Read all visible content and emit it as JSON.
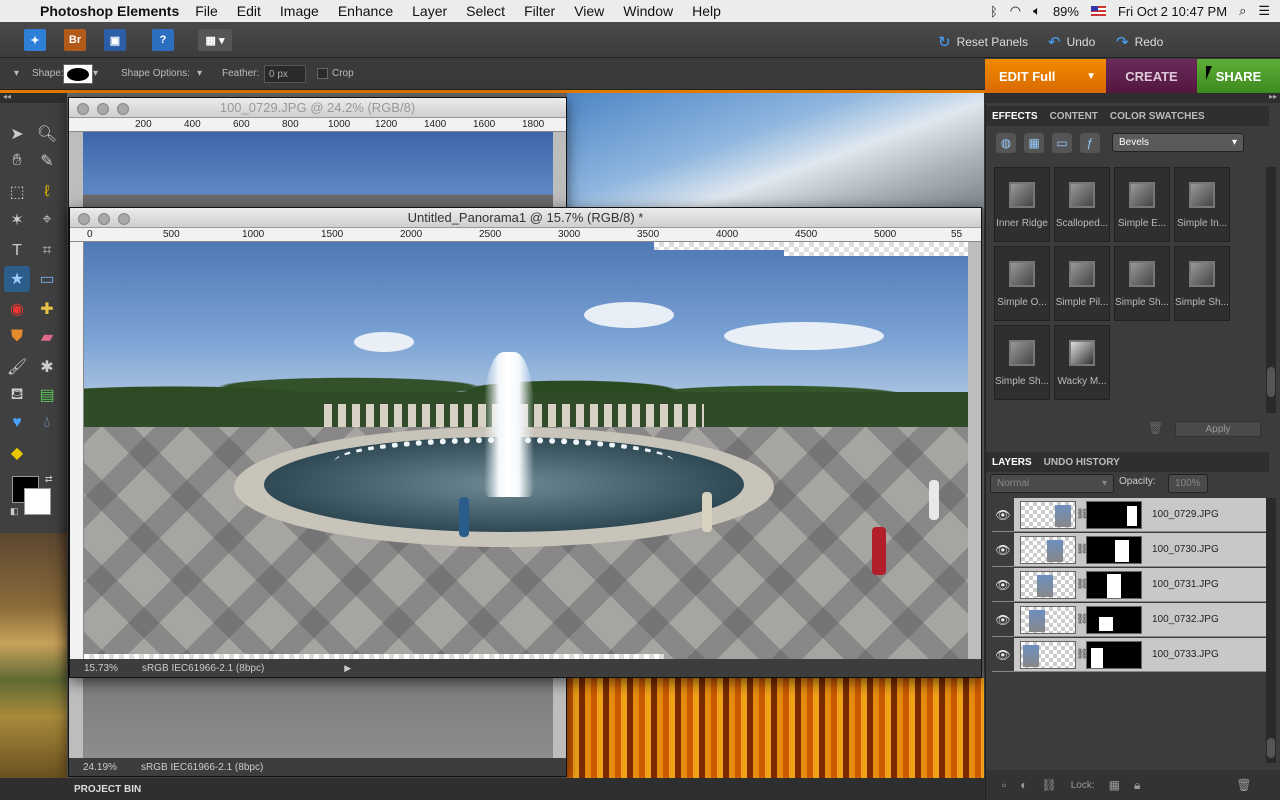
{
  "menubar": {
    "app_name": "Photoshop Elements",
    "items": [
      "File",
      "Edit",
      "Image",
      "Enhance",
      "Layer",
      "Select",
      "Filter",
      "View",
      "Window",
      "Help"
    ],
    "battery": "89%",
    "datetime": "Fri Oct 2  10:47 PM"
  },
  "apptoolbar": {
    "bridge_label": "Br",
    "reset_panels": "Reset Panels",
    "undo": "Undo",
    "redo": "Redo"
  },
  "options": {
    "shape_label": "Shape:",
    "shape_options_label": "Shape Options:",
    "feather_label": "Feather:",
    "feather_value": "0 px",
    "crop_label": "Crop"
  },
  "modes": {
    "edit": "EDIT Full",
    "create": "CREATE",
    "share": "SHARE"
  },
  "documents": {
    "back": {
      "title": "100_0729.JPG @ 24.2% (RGB/8)",
      "ruler": [
        "200",
        "400",
        "600",
        "800",
        "1000",
        "1200",
        "1400",
        "1600",
        "1800"
      ],
      "zoom": "24.19%",
      "profile": "sRGB IEC61966-2.1 (8bpc)"
    },
    "front": {
      "title": "Untitled_Panorama1 @ 15.7% (RGB/8) *",
      "ruler": [
        "0",
        "500",
        "1000",
        "1500",
        "2000",
        "2500",
        "3000",
        "3500",
        "4000",
        "4500",
        "5000",
        "55"
      ],
      "zoom": "15.73%",
      "profile": "sRGB IEC61966-2.1 (8bpc)"
    }
  },
  "effects_panel": {
    "tabs": [
      "EFFECTS",
      "CONTENT",
      "COLOR SWATCHES"
    ],
    "category": "Bevels",
    "items": [
      "Inner Ridge",
      "Scalloped...",
      "Simple E...",
      "Simple In...",
      "Simple O...",
      "Simple Pil...",
      "Simple Sh...",
      "Simple Sh...",
      "Simple Sh...",
      "Wacky M..."
    ],
    "apply": "Apply"
  },
  "layers_panel": {
    "tabs": [
      "LAYERS",
      "UNDO HISTORY"
    ],
    "blend_mode": "Normal",
    "opacity_label": "Opacity:",
    "opacity_value": "100%",
    "layers": [
      "100_0729.JPG",
      "100_0730.JPG",
      "100_0731.JPG",
      "100_0732.JPG",
      "100_0733.JPG"
    ],
    "lock_label": "Lock:"
  },
  "project_bin": "PROJECT BIN"
}
